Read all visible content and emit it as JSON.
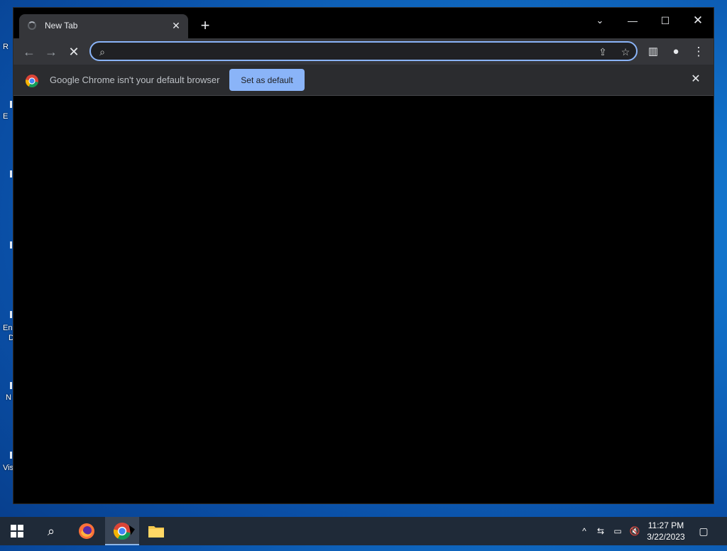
{
  "desktop": {
    "labels": [
      "R",
      "E",
      "En",
      "D",
      "N",
      "Vis"
    ]
  },
  "browser": {
    "tab": {
      "title": "New Tab"
    },
    "toolbar": {
      "back_icon": "arrow-left-icon",
      "forward_icon": "arrow-right-icon",
      "stop_icon": "close-icon"
    },
    "omnibox": {
      "value": "",
      "placeholder": ""
    },
    "infobar": {
      "message": "Google Chrome isn't your default browser",
      "button_label": "Set as default"
    }
  },
  "taskbar": {
    "clock": {
      "time": "11:27 PM",
      "date": "3/22/2023"
    }
  },
  "colors": {
    "accent": "#8ab4f8",
    "toolbar": "#35363a",
    "window": "#000000",
    "taskbar": "#1f2a38"
  }
}
